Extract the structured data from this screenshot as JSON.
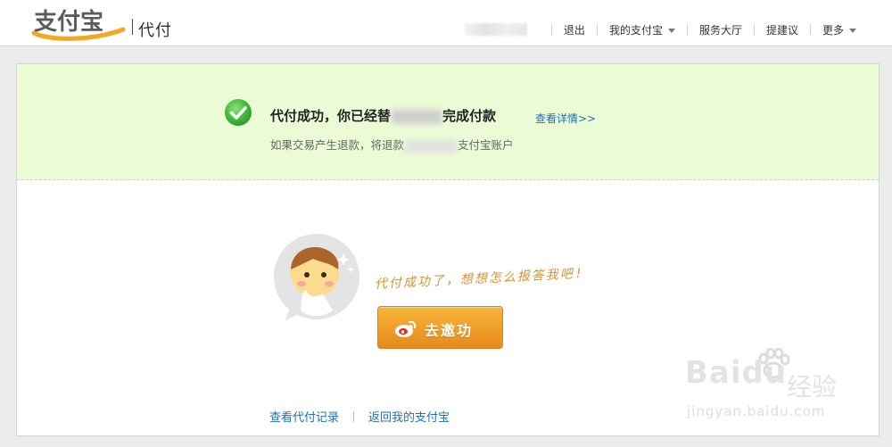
{
  "header": {
    "logo_text": "支付宝",
    "product": "代付",
    "nav": {
      "logout": "退出",
      "my_alipay": "我的支付宝",
      "service_hall": "服务大厅",
      "feedback": "提建议",
      "more": "更多"
    }
  },
  "success": {
    "title_before": "代付成功，你已经替",
    "title_after": "完成付款",
    "detail_link": "查看详情>>",
    "refund_before": "如果交易产生退款，将退款",
    "refund_after": "支付宝账户"
  },
  "promo": {
    "thanks_text": "代付成功了，想想怎么报答我吧！",
    "weibo_button": "去邀功"
  },
  "footer_links": {
    "history": "查看代付记录",
    "back": "返回我的支付宝"
  },
  "watermark": {
    "brand": "Baidu",
    "brand_cn": "经验",
    "url": "jingyan.baidu.com"
  },
  "colors": {
    "success_bg": "#eafbd6",
    "link": "#1f6fbd",
    "brand_orange": "#e8891c"
  }
}
